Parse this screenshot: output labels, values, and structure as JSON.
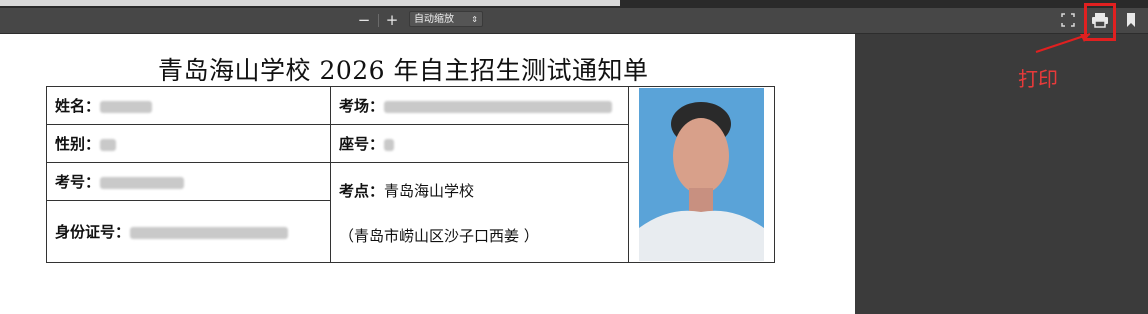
{
  "toolbar": {
    "zoom_out": "−",
    "zoom_in": "+",
    "zoom_select": "自动缩放"
  },
  "document": {
    "title": "青岛海山学校 2026 年自主招生测试通知单",
    "name_label": "姓名：",
    "gender_label": "性别：",
    "exam_no_label": "考号：",
    "id_label": "身份证号：",
    "room_label": "考场：",
    "seat_label": "座号：",
    "site_label": "考点：",
    "site_value": "青岛海山学校",
    "address": "（青岛市崂山区沙子口西姜 ）"
  },
  "annotation": {
    "label": "打印",
    "color": "#e02020"
  }
}
